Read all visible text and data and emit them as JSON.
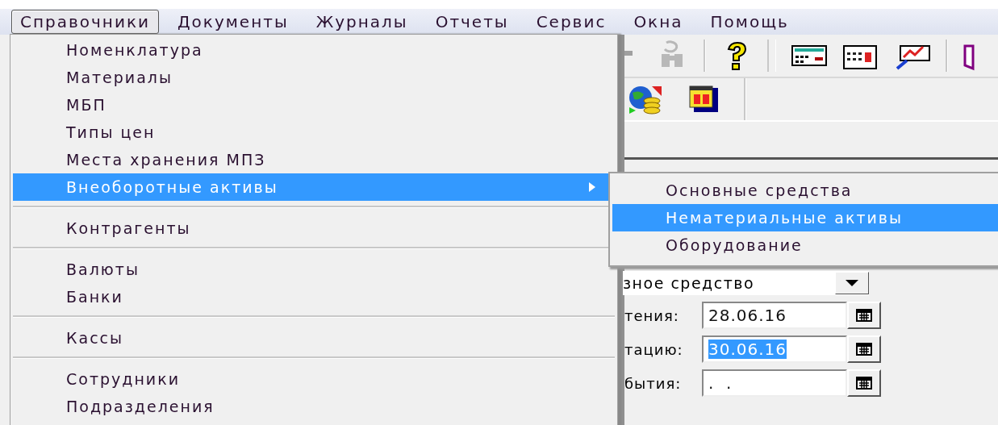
{
  "menubar": [
    {
      "label": "Справочники",
      "selected": true
    },
    {
      "label": "Документы",
      "selected": false
    },
    {
      "label": "Журналы",
      "selected": false
    },
    {
      "label": "Отчеты",
      "selected": false
    },
    {
      "label": "Сервис",
      "selected": false
    },
    {
      "label": "Окна",
      "selected": false
    },
    {
      "label": "Помощь",
      "selected": false
    }
  ],
  "open_menu": {
    "items": [
      {
        "kind": "item",
        "label": "Номенклатура",
        "selected": false,
        "has_submenu": false
      },
      {
        "kind": "item",
        "label": "Материалы",
        "selected": false,
        "has_submenu": false
      },
      {
        "kind": "item",
        "label": "МБП",
        "selected": false,
        "has_submenu": false
      },
      {
        "kind": "item",
        "label": "Типы цен",
        "selected": false,
        "has_submenu": false
      },
      {
        "kind": "item",
        "label": "Места хранения МПЗ",
        "selected": false,
        "has_submenu": false
      },
      {
        "kind": "item",
        "label": "Внеоборотные активы",
        "selected": true,
        "has_submenu": true
      },
      {
        "kind": "separator"
      },
      {
        "kind": "item",
        "label": "Контрагенты",
        "selected": false,
        "has_submenu": false
      },
      {
        "kind": "separator"
      },
      {
        "kind": "item",
        "label": "Валюты",
        "selected": false,
        "has_submenu": false
      },
      {
        "kind": "item",
        "label": "Банки",
        "selected": false,
        "has_submenu": false
      },
      {
        "kind": "separator"
      },
      {
        "kind": "item",
        "label": "Кассы",
        "selected": false,
        "has_submenu": false
      },
      {
        "kind": "separator"
      },
      {
        "kind": "item",
        "label": "Сотрудники",
        "selected": false,
        "has_submenu": false
      },
      {
        "kind": "item",
        "label": "Подразделения",
        "selected": false,
        "has_submenu": false
      }
    ]
  },
  "submenu": {
    "items": [
      {
        "label": "Основные средства",
        "selected": false
      },
      {
        "label": "Нематериальные активы",
        "selected": true
      },
      {
        "label": "Оборудование",
        "selected": false
      }
    ]
  },
  "form": {
    "combo": {
      "value": "зное средство"
    },
    "date_fields": [
      {
        "label": "тения:",
        "value": "28.06.16",
        "text_selected": false
      },
      {
        "label": "тацию:",
        "value": "30.06.16",
        "text_selected": true
      },
      {
        "label": "бытия:",
        "value": ".  .",
        "text_selected": false
      }
    ]
  }
}
